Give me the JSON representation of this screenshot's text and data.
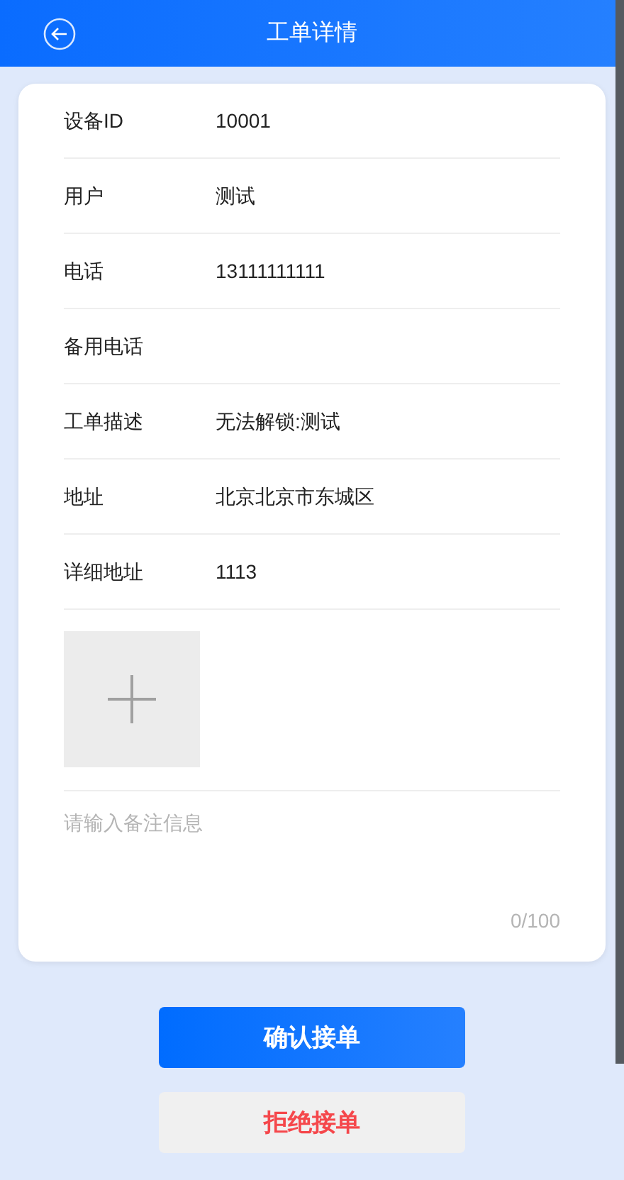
{
  "header": {
    "title": "工单详情"
  },
  "fields": [
    {
      "label": "设备ID",
      "value": "10001"
    },
    {
      "label": "用户",
      "value": "测试"
    },
    {
      "label": "电话",
      "value": "13111111111"
    },
    {
      "label": "备用电话"
    },
    {
      "label": "工单描述",
      "value": "无法解锁:测试"
    },
    {
      "label": "地址",
      "value": "北京北京市东城区"
    },
    {
      "label": "详细地址",
      "value": "1113"
    }
  ],
  "remark": {
    "placeholder": "请输入备注信息",
    "counter": "0/100"
  },
  "buttons": [
    {
      "label": "确认接单",
      "kind": "primary"
    },
    {
      "label": "拒绝接单",
      "kind": "danger"
    }
  ]
}
